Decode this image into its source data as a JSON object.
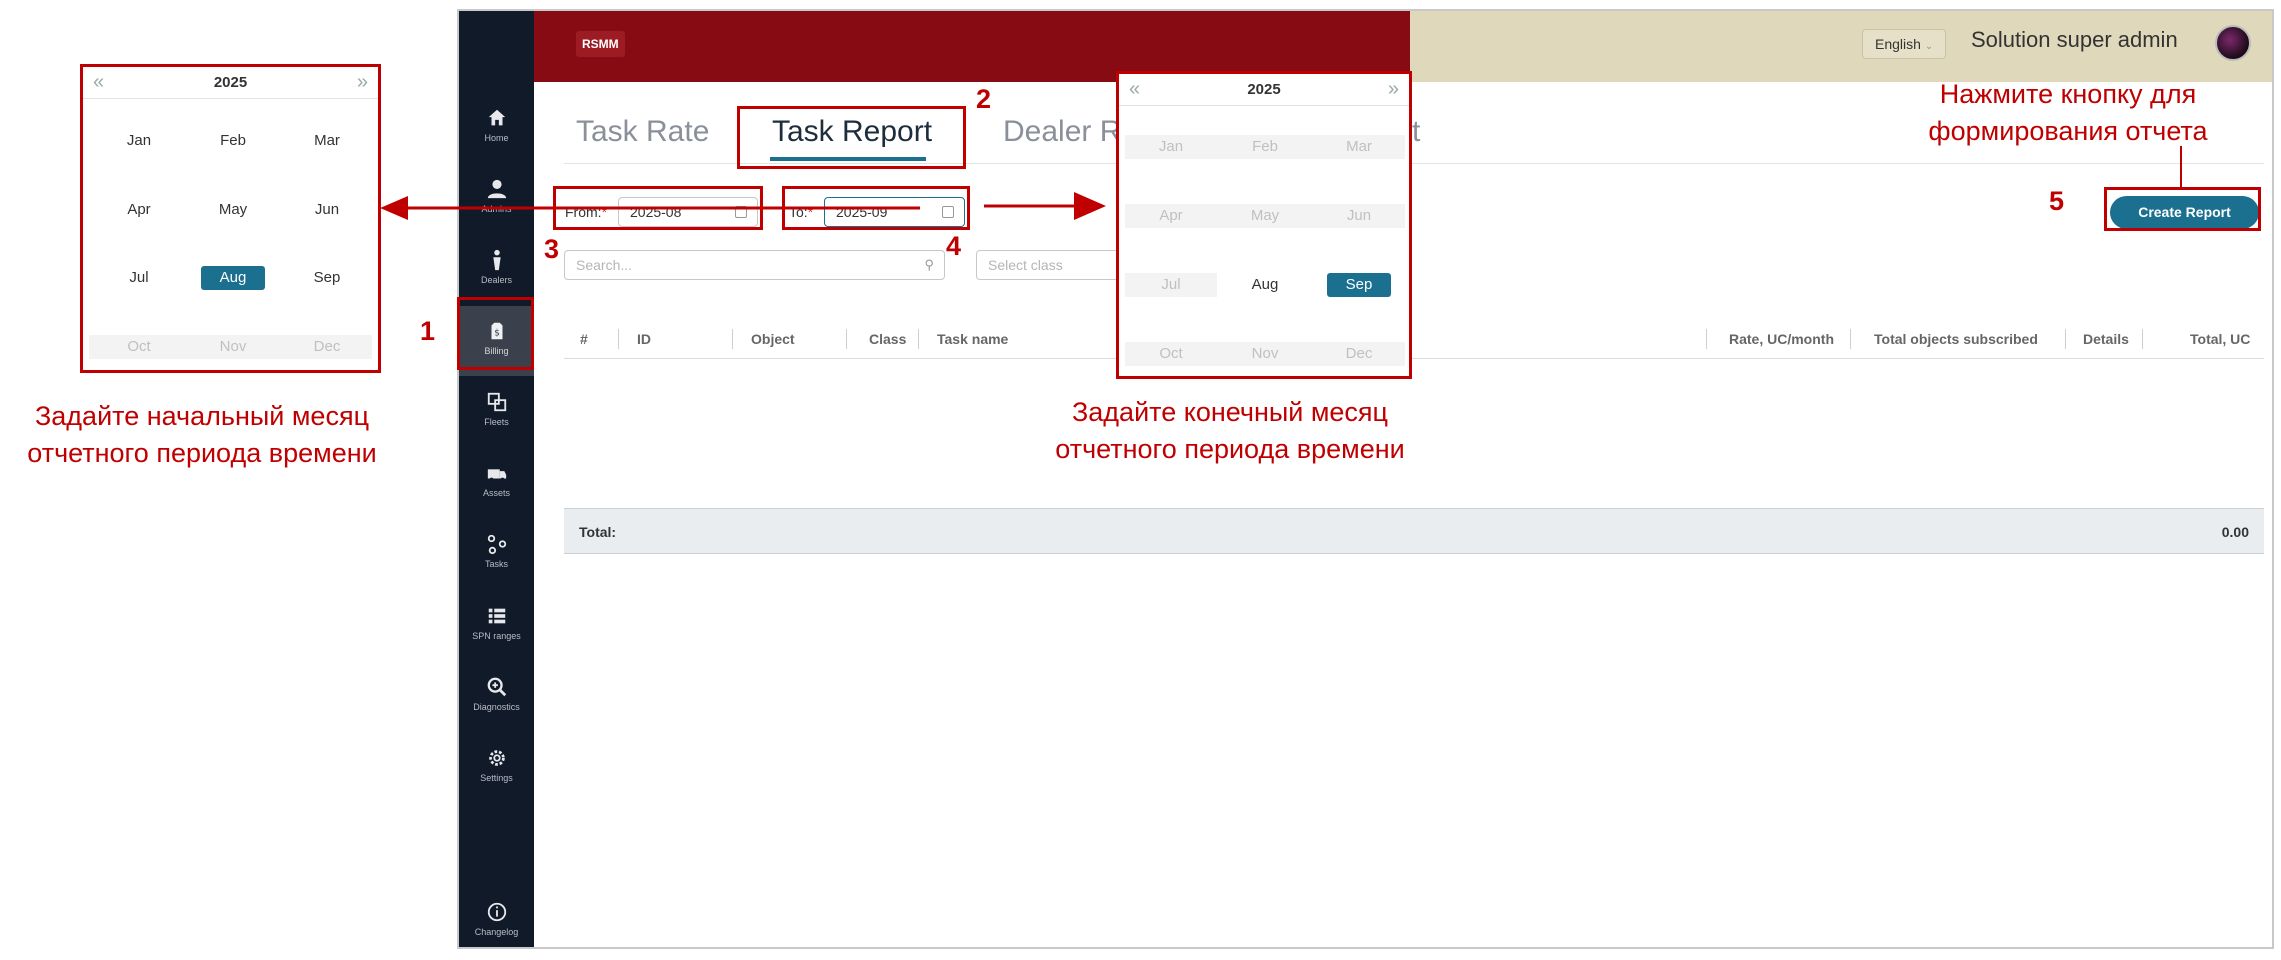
{
  "app": {
    "logo": "RSMM",
    "language": "English",
    "user_name": "Solution super admin"
  },
  "sidebar": {
    "items": [
      {
        "label": "Home",
        "icon": "home-icon"
      },
      {
        "label": "Admins",
        "icon": "user-icon"
      },
      {
        "label": "Dealers",
        "icon": "person-icon"
      },
      {
        "label": "Billing",
        "icon": "billing-icon"
      },
      {
        "label": "Fleets",
        "icon": "fleets-icon"
      },
      {
        "label": "Assets",
        "icon": "truck-icon"
      },
      {
        "label": "Tasks",
        "icon": "tasks-icon"
      },
      {
        "label": "SPN ranges",
        "icon": "list-icon"
      },
      {
        "label": "Diagnostics",
        "icon": "zoom-icon"
      },
      {
        "label": "Settings",
        "icon": "gear-icon"
      },
      {
        "label": "Changelog",
        "icon": "info-icon"
      }
    ]
  },
  "tabs": [
    {
      "label": "Task Rate"
    },
    {
      "label": "Task Report"
    },
    {
      "label": "Dealer R"
    },
    {
      "label": "t"
    }
  ],
  "filters": {
    "from_label": "From:",
    "from_value": "2025-08",
    "to_label": "To:",
    "to_value": "2025-09",
    "search_placeholder": "Search...",
    "class_placeholder": "Select class",
    "required_mark": "*"
  },
  "create_report_label": "Create Report",
  "table": {
    "columns": [
      "#",
      "ID",
      "Object",
      "Class",
      "Task name",
      "Rate, UC/month",
      "Total objects subscribed",
      "Details",
      "Total, UC"
    ],
    "total_label": "Total:",
    "total_value": "0.00"
  },
  "calendar_from": {
    "year": "2025",
    "prev": "«",
    "next": "»",
    "months": [
      "Jan",
      "Feb",
      "Mar",
      "Apr",
      "May",
      "Jun",
      "Jul",
      "Aug",
      "Sep",
      "Oct",
      "Nov",
      "Dec"
    ],
    "selected": "Aug"
  },
  "calendar_to": {
    "year": "2025",
    "prev": "«",
    "next": "»",
    "months": [
      "Jan",
      "Feb",
      "Mar",
      "Apr",
      "May",
      "Jun",
      "Jul",
      "Aug",
      "Sep",
      "Oct",
      "Nov",
      "Dec"
    ],
    "selected": "Sep"
  },
  "annotations": {
    "n1": "1",
    "n2": "2",
    "n3": "3",
    "n4": "4",
    "n5": "5",
    "start_month_line1": "Задайте начальный месяц",
    "start_month_line2": "отчетного периода времени",
    "end_month_line1": "Задайте конечный месяц",
    "end_month_line2": "отчетного периода времени",
    "create_line1": "Нажмите кнопку для",
    "create_line2": "формирования отчета"
  },
  "colors": {
    "brand_red": "#860b12",
    "accent": "#1b6f8f",
    "annotation": "#c00000",
    "sidebar": "#111a28"
  }
}
